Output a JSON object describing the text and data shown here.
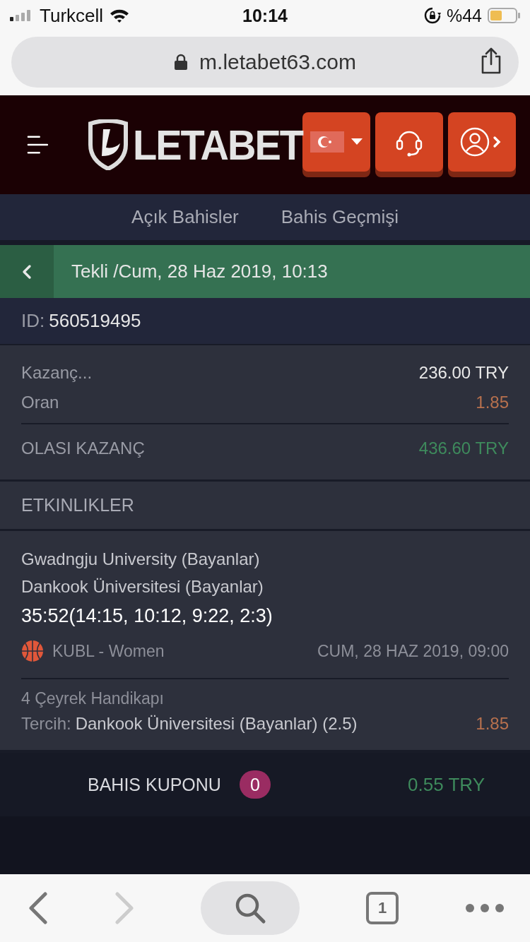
{
  "status_bar": {
    "carrier": "Turkcell",
    "time": "10:14",
    "battery": "%44"
  },
  "address_bar": {
    "url": "m.letabet63.com"
  },
  "header": {
    "logo": "LETABET"
  },
  "tabs": [
    {
      "label": "Açık Bahisler",
      "selected": false
    },
    {
      "label": "Bahis Geçmişi",
      "selected": false
    }
  ],
  "bet_header": {
    "title": "Tekli /Cum, 28 Haz 2019, 10:13"
  },
  "bet_id": {
    "label": "ID:",
    "value": "560519495"
  },
  "summary": {
    "rows": [
      {
        "label": "Kazanç...",
        "value": "236.00 TRY",
        "kind": "amount"
      },
      {
        "label": "Oran",
        "value": "1.85",
        "kind": "odds"
      }
    ],
    "total": {
      "label": "OLASI KAZANÇ",
      "value": "436.60 TRY"
    }
  },
  "events_title": "ETKINLIKLER",
  "event": {
    "teams": [
      "Gwadngju University (Bayanlar)",
      "Dankook Üniversitesi (Bayanlar)"
    ],
    "score": "35:52(14:15, 10:12, 9:22, 2:3)",
    "league": "KUBL - Women",
    "date": "CUM, 28 HAZ 2019, 09:00",
    "market": "4 Çeyrek Handikapı",
    "choice_label": "Tercih:",
    "choice": "Dankook Üniversitesi (Bayanlar) (2.5)",
    "odds": "1.85"
  },
  "bet_slip": {
    "label": "BAHIS KUPONU",
    "count": "0",
    "amount": "0.55 TRY"
  },
  "browser_toolbar": {
    "tab_count": "1"
  }
}
